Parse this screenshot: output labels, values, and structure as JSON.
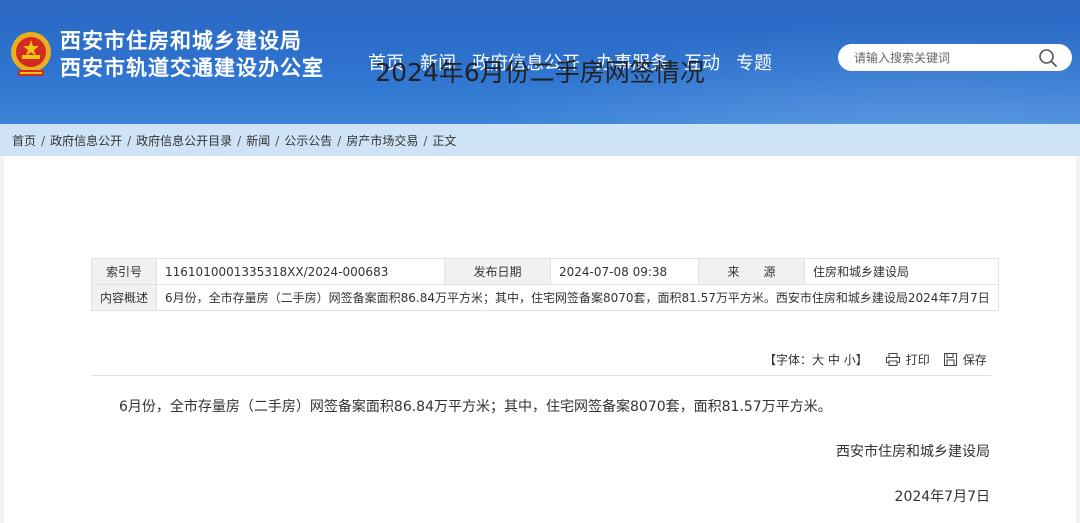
{
  "header": {
    "title_line1": "西安市住房和城乡建设局",
    "title_line2": "西安市轨道交通建设办公室",
    "nav": [
      "首页",
      "新闻",
      "政府信息公开",
      "办事服务",
      "互动",
      "专题"
    ],
    "search_placeholder": "请输入搜索关键词"
  },
  "breadcrumb": [
    "首页",
    "政府信息公开",
    "政府信息公开目录",
    "新闻",
    "公示公告",
    "房产市场交易",
    "正文"
  ],
  "article": {
    "title": "2024年6月份二手房网签情况",
    "meta": {
      "index_label": "索引号",
      "index_value": "1161010001335318XX/2024-000683",
      "date_label": "发布日期",
      "date_value": "2024-07-08 09:38",
      "source_label": "来　　源",
      "source_value": "住房和城乡建设局",
      "summary_label": "内容概述",
      "summary_value": "6月份，全市存量房（二手房）网签备案面积86.84万平方米；其中，住宅网签备案8070套，面积81.57万平方米。西安市住房和城乡建设局2024年7月7日"
    },
    "toolbar": {
      "font_prefix": "【字体：",
      "font_large": "大",
      "font_medium": "中",
      "font_small": "小",
      "font_suffix": "】",
      "print": "打印",
      "save": "保存"
    },
    "body": "6月份，全市存量房（二手房）网签备案面积86.84万平方米；其中，住宅网签备案8070套，面积81.57万平方米。",
    "signature": "西安市住房和城乡建设局",
    "date": "2024年7月7日"
  }
}
